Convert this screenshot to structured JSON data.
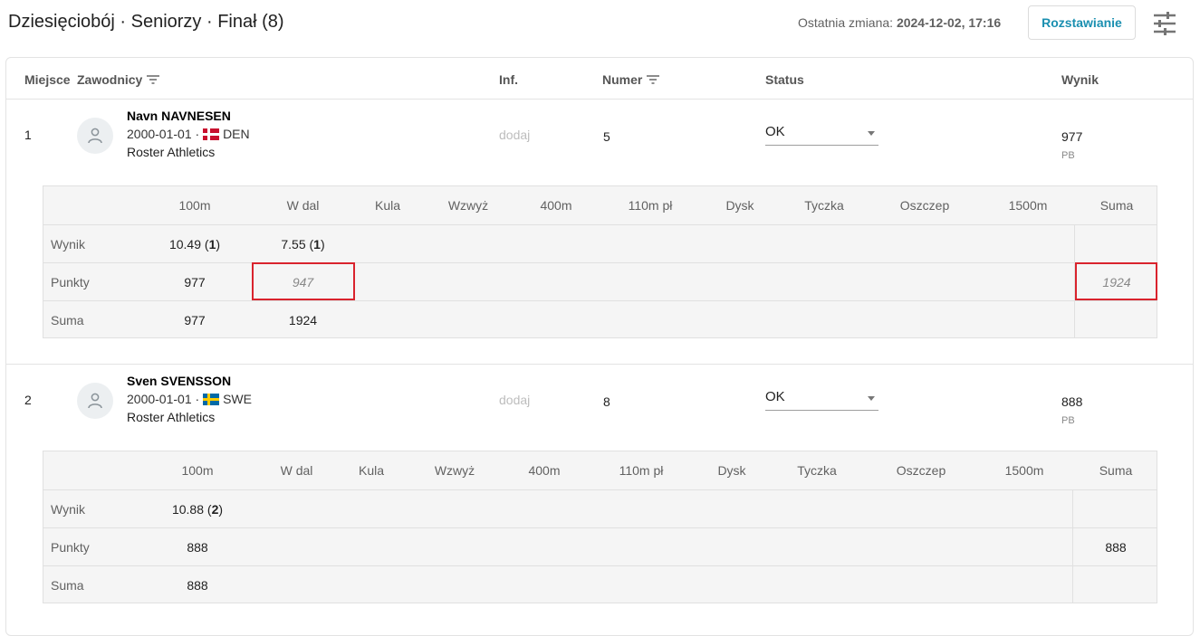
{
  "header": {
    "title": "Dziesięciobój · Seniorzy · Finał (8)",
    "last_change_label": "Ostatnia zmiana:",
    "last_change_value": "2024-12-02, 17:16",
    "seed_button": "Rozstawianie",
    "settings_icon": "tune-icon"
  },
  "columns": {
    "place": "Miejsce",
    "athletes": "Zawodnicy",
    "info": "Inf.",
    "number": "Numer",
    "status": "Status",
    "result": "Wynik"
  },
  "events": [
    "100m",
    "W dal",
    "Kula",
    "Wzwyż",
    "400m",
    "110m pł",
    "Dysk",
    "Tyczka",
    "Oszczep",
    "1500m",
    "Suma"
  ],
  "row_labels": {
    "result": "Wynik",
    "points": "Punkty",
    "sum": "Suma"
  },
  "athletes": [
    {
      "rank": "1",
      "name": "Navn NAVNESEN",
      "birth": "2000-01-01 ·",
      "country": "DEN",
      "club": "Roster Athletics",
      "info": "dodaj",
      "number": "5",
      "status": "OK",
      "result": "977",
      "result_note": "PB",
      "table": {
        "results": [
          {
            "value": "10.49",
            "place": "1"
          },
          {
            "value": "7.55",
            "place": "1"
          }
        ],
        "points": [
          "977",
          "947"
        ],
        "points_total": "1924",
        "sums": [
          "977",
          "1924"
        ]
      }
    },
    {
      "rank": "2",
      "name": "Sven SVENSSON",
      "birth": "2000-01-01 ·",
      "country": "SWE",
      "club": "Roster Athletics",
      "info": "dodaj",
      "number": "8",
      "status": "OK",
      "result": "888",
      "result_note": "PB",
      "table": {
        "results": [
          {
            "value": "10.88",
            "place": "2"
          }
        ],
        "points": [
          "888"
        ],
        "points_total": "888",
        "sums": [
          "888"
        ]
      }
    }
  ],
  "colors": {
    "accent": "#1a8fb0",
    "highlight": "#d9232d"
  }
}
